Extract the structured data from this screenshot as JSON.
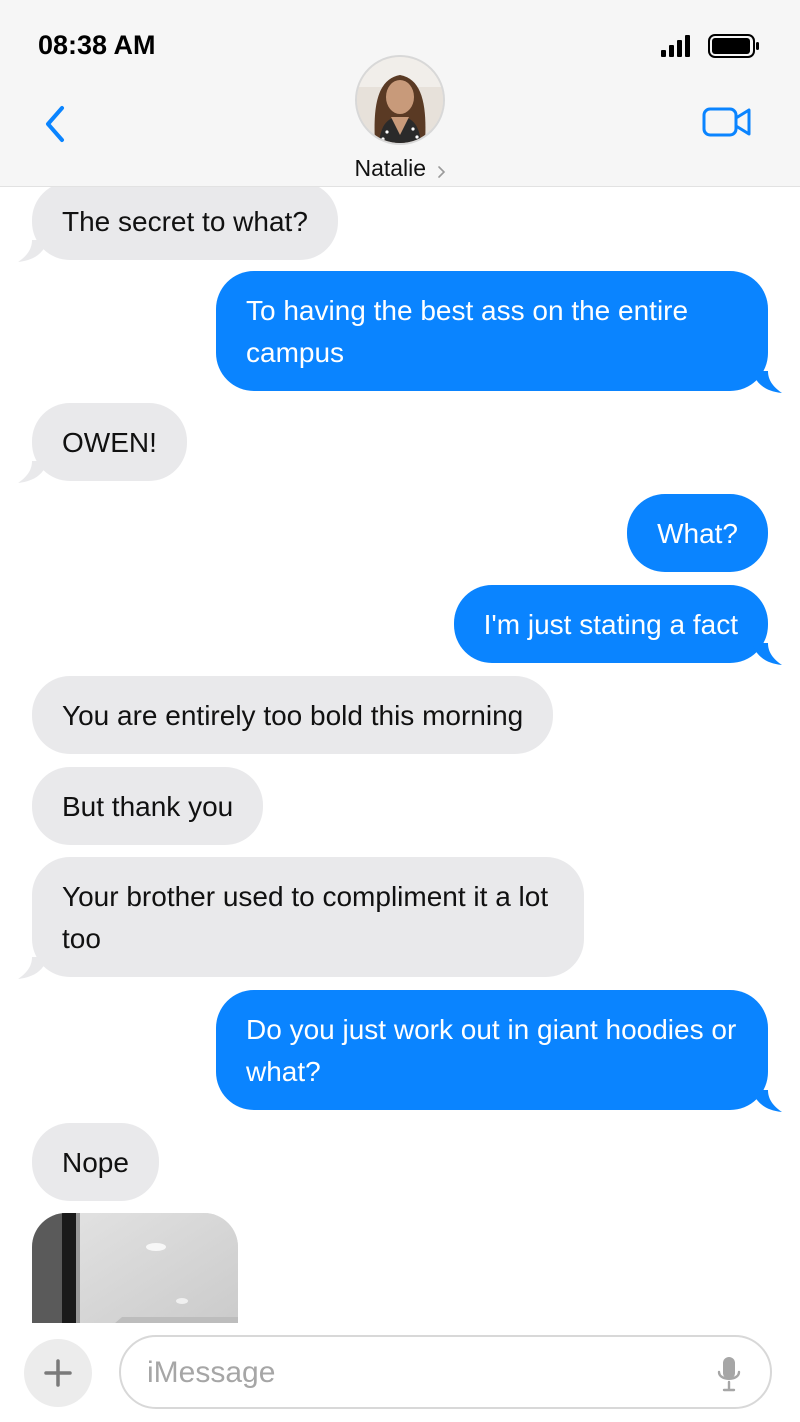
{
  "status_bar": {
    "time": "08:38 AM"
  },
  "header": {
    "contact_name": "Natalie"
  },
  "colors": {
    "accent": "#0a84ff",
    "incoming_bubble": "#e9e9eb",
    "header_bg": "#f6f6f6"
  },
  "messages": [
    {
      "direction": "incoming",
      "text": "The secret to what?"
    },
    {
      "direction": "outgoing",
      "text": "To having the best ass on the entire campus"
    },
    {
      "direction": "incoming",
      "text": "OWEN!"
    },
    {
      "direction": "outgoing",
      "text": "What?"
    },
    {
      "direction": "outgoing",
      "text": "I'm just stating a fact"
    },
    {
      "direction": "incoming",
      "text": "You are entirely too bold this morning"
    },
    {
      "direction": "incoming",
      "text": "But thank you"
    },
    {
      "direction": "incoming",
      "text": "Your brother used to compliment it a lot too"
    },
    {
      "direction": "outgoing",
      "text": "Do you just work out in giant hoodies or what?"
    },
    {
      "direction": "incoming",
      "text": "Nope"
    },
    {
      "direction": "incoming",
      "type": "photo"
    }
  ],
  "input": {
    "placeholder": "iMessage",
    "value": ""
  },
  "icons": {
    "back": "chevron-left-icon",
    "video": "video-camera-icon",
    "add": "plus-icon",
    "mic": "microphone-icon",
    "signal": "signal-icon",
    "battery": "battery-icon"
  }
}
